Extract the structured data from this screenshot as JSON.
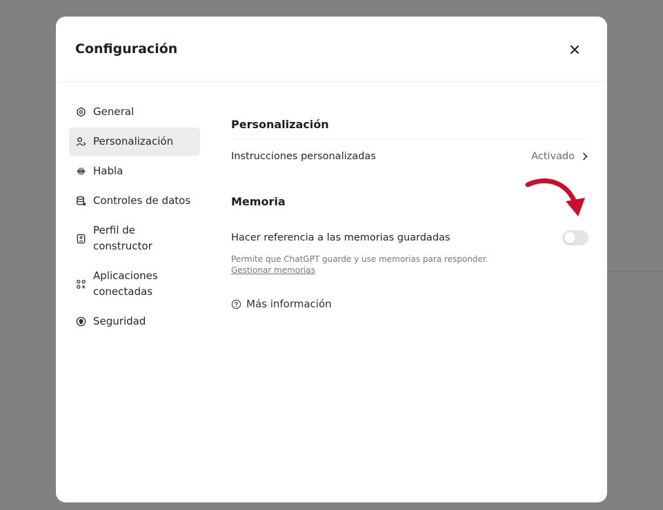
{
  "modal": {
    "title": "Configuración",
    "close_icon": "close-icon"
  },
  "sidebar": {
    "items": [
      {
        "label": "General",
        "icon": "gear-icon",
        "active": false
      },
      {
        "label": "Personalización",
        "icon": "person-icon",
        "active": true
      },
      {
        "label": "Habla",
        "icon": "waveform-icon",
        "active": false
      },
      {
        "label": "Controles de datos",
        "icon": "database-icon",
        "active": false
      },
      {
        "label_line1": "Perfil de",
        "label_line2": "constructor",
        "icon": "id-card-icon",
        "active": false
      },
      {
        "label_line1": "Aplicaciones",
        "label_line2": "conectadas",
        "icon": "apps-icon",
        "active": false
      },
      {
        "label": "Seguridad",
        "icon": "shield-icon",
        "active": false
      }
    ]
  },
  "personalization": {
    "title": "Personalización",
    "custom_instructions": {
      "label": "Instrucciones personalizadas",
      "status": "Activado"
    }
  },
  "memory": {
    "title": "Memoria",
    "reference_saved": {
      "label": "Hacer referencia a las memorias guardadas",
      "enabled": false
    },
    "help_text": "Permite que ChatGPT guarde y use memorias para responder.",
    "manage_link": "Gestionar memorias"
  },
  "more_info": "Más información",
  "colors": {
    "overlay": "#808080",
    "annotation_arrow": "#c8102e",
    "toggle_off": "#e4e4e4"
  }
}
